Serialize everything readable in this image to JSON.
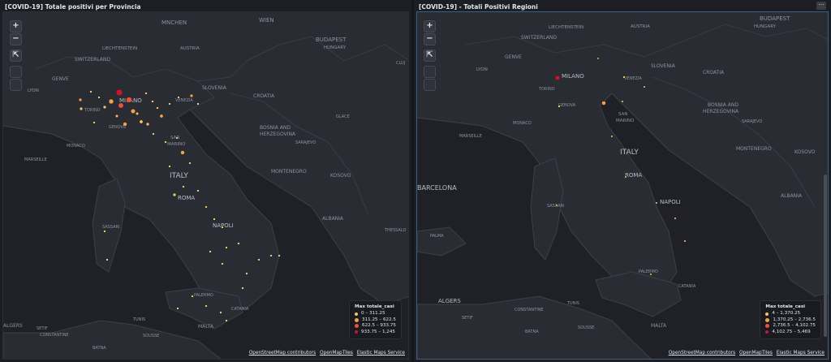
{
  "panels": [
    {
      "title": "[COVID-19] Totale positivi per Provincia",
      "legend": {
        "title": "Max totale_casi",
        "items": [
          {
            "label": "0 – 311.25",
            "color": "#f5c36b"
          },
          {
            "label": "311.25 – 622.5",
            "color": "#f0a24a"
          },
          {
            "label": "622.5 – 933.75",
            "color": "#e4543b"
          },
          {
            "label": "933.75 – 1,245",
            "color": "#c2182b"
          }
        ]
      },
      "place_labels": [
        "MNCHEN",
        "WIEN",
        "BUDAPEST",
        "HUNGARY",
        "LIECHTENSTEIN",
        "AUSTRIA",
        "SWITZERLAND",
        "GENVE",
        "LYON",
        "MILANO",
        "SLOVENIA",
        "VENEZIA",
        "CROATIA",
        "TORINO",
        "GENOVA",
        "GLACE",
        "BOSNIA AND",
        "HERZEGOVINA",
        "MONACO",
        "SARAJEVO",
        "MARSEILLE",
        "SAN",
        "MARINO",
        "MONTENEGRO",
        "KOSOVO",
        "ITALY",
        "ROMA",
        "ALBANIA",
        "SASSARI",
        "NAPOLI",
        "THESSALO",
        "PALERMO",
        "CATANIA",
        "SETIF",
        "BATNA",
        "CONSTANTINE",
        "TUNIS",
        "SOUSSE",
        "MALTA",
        "ALGERS",
        "CLUJ"
      ]
    },
    {
      "title": "[COVID-19] - Totali Positivi Regioni",
      "legend": {
        "title": "Max totale_casi",
        "items": [
          {
            "label": "4 – 1,370.25",
            "color": "#f5c36b"
          },
          {
            "label": "1,370.25 – 2,736.5",
            "color": "#f0a24a"
          },
          {
            "label": "2,736.5 – 4,102.75",
            "color": "#e4543b"
          },
          {
            "label": "4,102.75 – 5,469",
            "color": "#c2182b"
          }
        ]
      },
      "place_labels": [
        "BUDAPEST",
        "HUNGARY",
        "LIECHTENSTEIN",
        "AUSTRIA",
        "SWITZERLAND",
        "GENVE",
        "LYON",
        "MILANO",
        "SLOVENIA",
        "VENEZIA",
        "CROATIA",
        "TORINO",
        "GENOVA",
        "BOSNIA AND",
        "HERZEGOVINA",
        "MONACO",
        "SARAJEVO",
        "MARSEILLE",
        "SAN",
        "MARINO",
        "MONTENEGRO",
        "KOSOVO",
        "ITALY",
        "ROMA",
        "BARCELONA",
        "ALBANIA",
        "SASSARI",
        "NAPOLI",
        "PALMA",
        "PALERMO",
        "CATANIA",
        "ALGERS",
        "CONSTANTINE",
        "SETIF",
        "BATNA",
        "TUNIS",
        "SOUSSE",
        "MALTA"
      ]
    }
  ],
  "attribution": [
    "OpenStreetMap contributors",
    "OpenMapTiles",
    "Elastic Maps Service"
  ],
  "controls": {
    "zoom_in": "+",
    "zoom_out": "−",
    "fit": "⇱"
  },
  "menu_icon": "···"
}
